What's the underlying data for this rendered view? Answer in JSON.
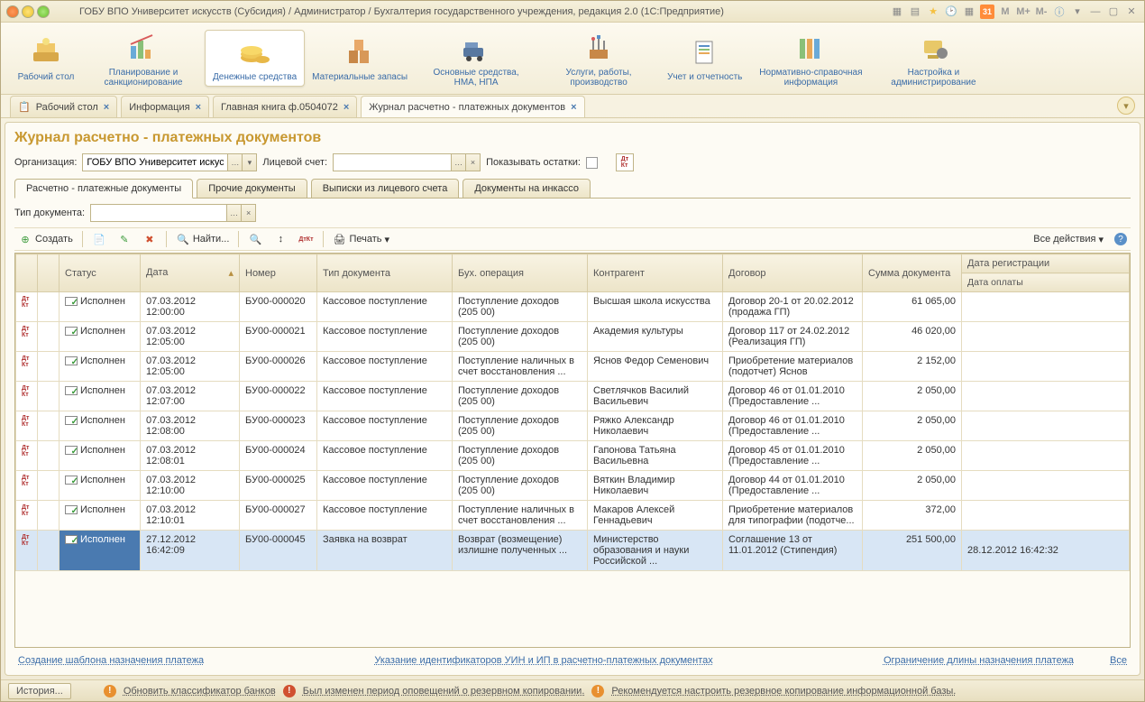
{
  "titlebar": {
    "title": "ГОБУ ВПО Университет искусств (Субсидия) / Администратор / Бухгалтерия государственного учреждения, редакция 2.0  (1С:Предприятие)",
    "m1": "M",
    "m2": "M+",
    "m3": "M-",
    "cal": "31"
  },
  "sections": [
    {
      "label": "Рабочий\nстол"
    },
    {
      "label": "Планирование и\nсанкционирование"
    },
    {
      "label": "Денежные\nсредства",
      "active": true
    },
    {
      "label": "Материальные\nзапасы"
    },
    {
      "label": "Основные средства,\nНМА, НПА"
    },
    {
      "label": "Услуги, работы,\nпроизводство"
    },
    {
      "label": "Учет и\nотчетность"
    },
    {
      "label": "Нормативно-справочная\nинформация"
    },
    {
      "label": "Настройка и\nадминистрирование"
    }
  ],
  "tabs": [
    {
      "label": "Рабочий стол"
    },
    {
      "label": "Информация"
    },
    {
      "label": "Главная книга ф.0504072"
    },
    {
      "label": "Журнал расчетно - платежных документов",
      "active": true
    }
  ],
  "page": {
    "title": "Журнал расчетно - платежных документов"
  },
  "filters": {
    "org_label": "Организация:",
    "org_value": "ГОБУ ВПО Университет искусс",
    "account_label": "Лицевой счет:",
    "account_value": "",
    "show_balance_label": "Показывать остатки:"
  },
  "subtabs": [
    {
      "label": "Расчетно - платежные документы",
      "active": true
    },
    {
      "label": "Прочие документы"
    },
    {
      "label": "Выписки из лицевого счета"
    },
    {
      "label": "Документы на инкассо"
    }
  ],
  "doctype": {
    "label": "Тип документа:",
    "value": ""
  },
  "actions": {
    "create": "Создать",
    "find": "Найти...",
    "print": "Печать",
    "all": "Все действия"
  },
  "columns": {
    "status": "Статус",
    "date": "Дата",
    "number": "Номер",
    "doctype": "Тип документа",
    "operation": "Бух. операция",
    "counterparty": "Контрагент",
    "contract": "Договор",
    "amount": "Сумма документа",
    "reg_date": "Дата регистрации",
    "pay_date": "Дата оплаты"
  },
  "rows": [
    {
      "status": "Исполнен",
      "date": "07.03.2012 12:00:00",
      "number": "БУ00-000020",
      "doctype": "Кассовое поступление",
      "operation": "Поступление доходов (205 00)",
      "counterparty": "Высшая школа искусства",
      "contract": "Договор 20-1 от 20.02.2012 (продажа ГП)",
      "amount": "61 065,00",
      "reg": "",
      "pay": ""
    },
    {
      "status": "Исполнен",
      "date": "07.03.2012 12:05:00",
      "number": "БУ00-000021",
      "doctype": "Кассовое поступление",
      "operation": "Поступление доходов (205 00)",
      "counterparty": "Академия культуры",
      "contract": "Договор 117 от 24.02.2012 (Реализация ГП)",
      "amount": "46 020,00",
      "reg": "",
      "pay": ""
    },
    {
      "status": "Исполнен",
      "date": "07.03.2012 12:05:00",
      "number": "БУ00-000026",
      "doctype": "Кассовое поступление",
      "operation": "Поступление наличных в счет восстановления ...",
      "counterparty": "Яснов Федор Семенович",
      "contract": "Приобретение материалов (подотчет) Яснов",
      "amount": "2 152,00",
      "reg": "",
      "pay": ""
    },
    {
      "status": "Исполнен",
      "date": "07.03.2012 12:07:00",
      "number": "БУ00-000022",
      "doctype": "Кассовое поступление",
      "operation": "Поступление доходов (205 00)",
      "counterparty": "Светлячков Василий Васильевич",
      "contract": "Договор 46 от 01.01.2010 (Предоставление ...",
      "amount": "2 050,00",
      "reg": "",
      "pay": ""
    },
    {
      "status": "Исполнен",
      "date": "07.03.2012 12:08:00",
      "number": "БУ00-000023",
      "doctype": "Кассовое поступление",
      "operation": "Поступление доходов (205 00)",
      "counterparty": "Ряжко Александр Николаевич",
      "contract": "Договор 46 от 01.01.2010 (Предоставление ...",
      "amount": "2 050,00",
      "reg": "",
      "pay": ""
    },
    {
      "status": "Исполнен",
      "date": "07.03.2012 12:08:01",
      "number": "БУ00-000024",
      "doctype": "Кассовое поступление",
      "operation": "Поступление доходов (205 00)",
      "counterparty": "Гапонова Татьяна Васильевна",
      "contract": "Договор 45 от 01.01.2010 (Предоставление ...",
      "amount": "2 050,00",
      "reg": "",
      "pay": ""
    },
    {
      "status": "Исполнен",
      "date": "07.03.2012 12:10:00",
      "number": "БУ00-000025",
      "doctype": "Кассовое поступление",
      "operation": "Поступление доходов (205 00)",
      "counterparty": "Вяткин Владимир Николаевич",
      "contract": "Договор 44 от 01.01.2010 (Предоставление ...",
      "amount": "2 050,00",
      "reg": "",
      "pay": ""
    },
    {
      "status": "Исполнен",
      "date": "07.03.2012 12:10:01",
      "number": "БУ00-000027",
      "doctype": "Кассовое поступление",
      "operation": "Поступление наличных в счет восстановления ...",
      "counterparty": "Макаров Алексей Геннадьевич",
      "contract": "Приобретение материалов для типографии (подотче...",
      "amount": "372,00",
      "reg": "",
      "pay": ""
    },
    {
      "status": "Исполнен",
      "date": "27.12.2012 16:42:09",
      "number": "БУ00-000045",
      "doctype": "Заявка на возврат",
      "operation": "Возврат (возмещение) излишне полученных ...",
      "counterparty": "Министерство образования и науки Российской ...",
      "contract": "Соглашение 13 от 11.01.2012 (Стипендия)",
      "amount": "251 500,00",
      "reg": "",
      "pay": "28.12.2012 16:42:32",
      "sel": true
    }
  ],
  "links": {
    "l1": "Создание шаблона назначения платежа",
    "l2": "Указание идентификаторов УИН и ИП в расчетно-платежных документах",
    "l3": "Ограничение длины назначения платежа",
    "all": "Все"
  },
  "status": {
    "history": "История...",
    "msg1": "Обновить классификатор банков",
    "msg2": "Был изменен период оповещений о резервном копировании.",
    "msg3": "Рекомендуется настроить резервное копирование информационной базы."
  }
}
